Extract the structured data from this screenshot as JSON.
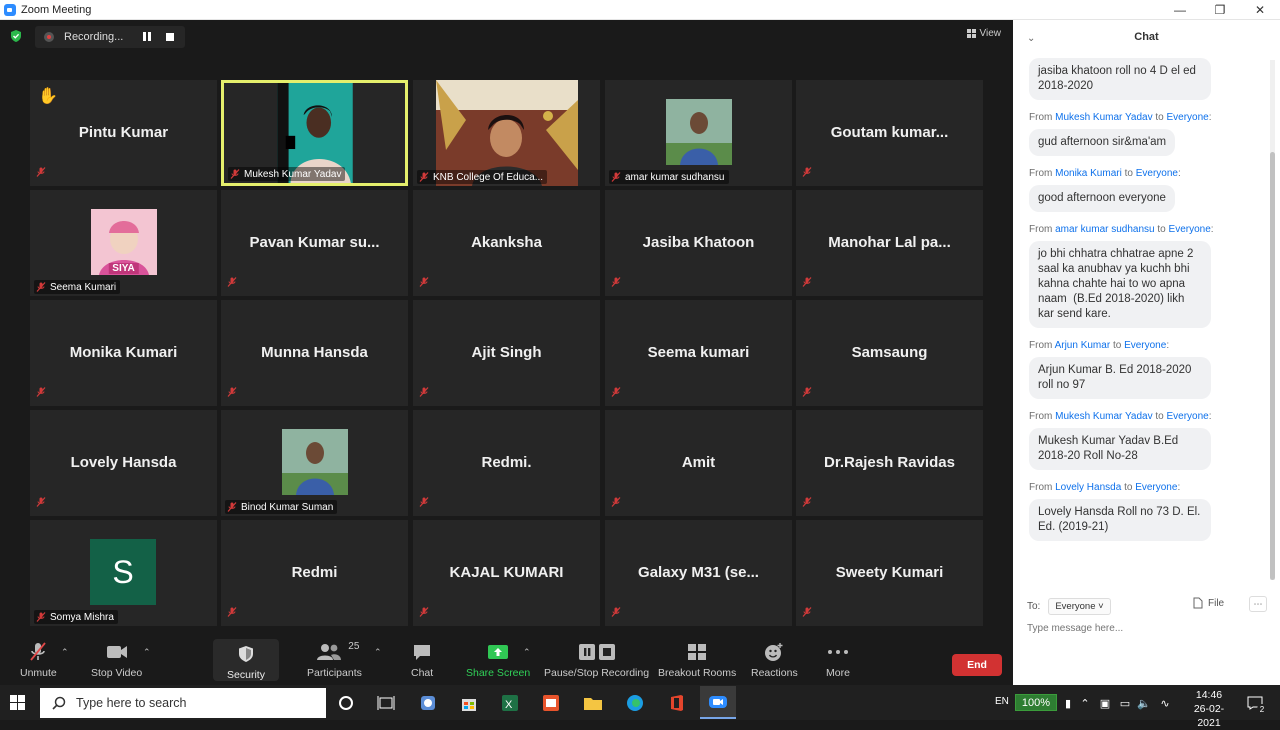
{
  "window": {
    "title": "Zoom Meeting"
  },
  "recording": {
    "label": "Recording..."
  },
  "view": {
    "label": "View"
  },
  "tiles": [
    {
      "name": "Pintu Kumar",
      "display": "name",
      "hand": true
    },
    {
      "name": "Mukesh Kumar Yadav",
      "display": "video",
      "active": true
    },
    {
      "name": "KNB College Of Educa...",
      "display": "video2"
    },
    {
      "name": "amar kumar sudhansu",
      "display": "photo"
    },
    {
      "name": "Goutam kumar...",
      "display": "name"
    },
    {
      "name": "Seema Kumari",
      "display": "photo-siya",
      "photo_text": "SIYA"
    },
    {
      "name": "Pavan Kumar su...",
      "display": "name"
    },
    {
      "name": "Akanksha",
      "display": "name"
    },
    {
      "name": "Jasiba Khatoon",
      "display": "name"
    },
    {
      "name": "Manohar Lal pa...",
      "display": "name"
    },
    {
      "name": "Monika Kumari",
      "display": "name"
    },
    {
      "name": "Munna Hansda",
      "display": "name"
    },
    {
      "name": "Ajit Singh",
      "display": "name"
    },
    {
      "name": "Seema kumari",
      "display": "name"
    },
    {
      "name": "Samsaung",
      "display": "name"
    },
    {
      "name": "Lovely Hansda",
      "display": "name"
    },
    {
      "name": "Binod Kumar Suman",
      "display": "photo"
    },
    {
      "name": "Redmi.",
      "display": "name"
    },
    {
      "name": "Amit",
      "display": "name"
    },
    {
      "name": "Dr.Rajesh Ravidas",
      "display": "name"
    },
    {
      "name": "Somya Mishra",
      "display": "avatar",
      "avatar_letter": "S"
    },
    {
      "name": "Redmi",
      "display": "name"
    },
    {
      "name": "KAJAL KUMARI",
      "display": "name"
    },
    {
      "name": "Galaxy M31 (se...",
      "display": "name"
    },
    {
      "name": "Sweety Kumari",
      "display": "name"
    }
  ],
  "toolbar": {
    "unmute": "Unmute",
    "stop_video": "Stop Video",
    "security": "Security",
    "participants": "Participants",
    "participants_count": "25",
    "chat": "Chat",
    "share_screen": "Share Screen",
    "pause_stop_recording": "Pause/Stop Recording",
    "breakout_rooms": "Breakout Rooms",
    "reactions": "Reactions",
    "more": "More",
    "end": "End"
  },
  "chat": {
    "title": "Chat",
    "first_bubble": "jasiba khatoon roll no 4 D el ed 2018-2020",
    "messages": [
      {
        "from": "Mukesh Kumar Yadav",
        "to": "Everyone",
        "text": "gud afternoon sir&ma'am"
      },
      {
        "from": "Monika Kumari",
        "to": "Everyone",
        "text": "good afternoon everyone"
      },
      {
        "from": "amar kumar sudhansu",
        "to": "Everyone",
        "text": "jo bhi chhatra chhatrae apne 2 saal ka anubhav ya kuchh bhi kahna chahte hai to wo apna naam  (B.Ed 2018-2020) likh kar send kare."
      },
      {
        "from": "Arjun Kumar",
        "to": "Everyone",
        "text": "Arjun Kumar B. Ed 2018-2020 roll no 97"
      },
      {
        "from": "Mukesh Kumar Yadav",
        "to": "Everyone",
        "text": "Mukesh Kumar Yadav B.Ed 2018-20 Roll No-28"
      },
      {
        "from": "Lovely Hansda",
        "to": "Everyone",
        "text": "Lovely Hansda Roll no 73 D. El. Ed. (2019-21)"
      }
    ],
    "from_word": "From",
    "to_word": "to",
    "to_label": "To:",
    "to_value": "Everyone",
    "file_label": "File",
    "input_placeholder": "Type message here..."
  },
  "taskbar": {
    "search_placeholder": "Type here to search",
    "lang": "EN",
    "battery": "100%",
    "time": "14:46",
    "date": "26-02-2021",
    "notification_count": "2"
  }
}
